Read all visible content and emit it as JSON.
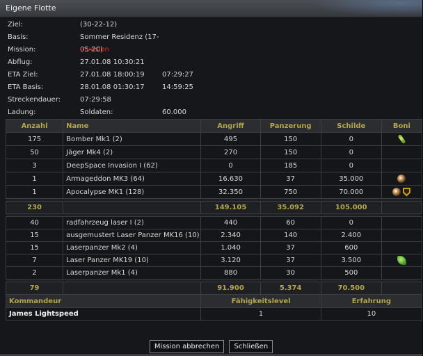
{
  "window": {
    "title": "Eigene Flotte"
  },
  "info": [
    {
      "label": "Ziel:",
      "v1": "(30-22-12)",
      "v2": "",
      "red": false
    },
    {
      "label": "Basis:",
      "v1": "Sommer Residenz (17-05-20)",
      "v2": "",
      "red": false
    },
    {
      "label": "Mission:",
      "v1": "Invasion",
      "v2": "",
      "red": true
    },
    {
      "label": "Abflug:",
      "v1": "27.01.08 10:30:21",
      "v2": "",
      "red": false
    },
    {
      "label": "ETA Ziel:",
      "v1": "27.01.08 18:00:19",
      "v2": "07:29:27",
      "red": false
    },
    {
      "label": "ETA Basis:",
      "v1": "28.01.08 01:30:17",
      "v2": "14:59:25",
      "red": false
    },
    {
      "label": "Streckendauer:",
      "v1": "07:29:58",
      "v2": "",
      "red": false
    },
    {
      "label": "Ladung:",
      "v1": "Soldaten:",
      "v2": "60.000",
      "red": false
    }
  ],
  "table": {
    "headers": {
      "count": "Anzahl",
      "name": "Name",
      "attack": "Angriff",
      "armor": "Panzerung",
      "shields": "Schilde",
      "bonus": "Boni"
    },
    "group1": [
      {
        "count": "175",
        "name": "Bomber Mk1 (2)",
        "attack": "495",
        "armor": "150",
        "shields": "0",
        "bonus": [
          "green-bonus-icon"
        ]
      },
      {
        "count": "50",
        "name": "Jäger Mk4 (2)",
        "attack": "270",
        "armor": "150",
        "shields": "0",
        "bonus": []
      },
      {
        "count": "3",
        "name": "DeepSpace Invasion I (62)",
        "attack": "0",
        "armor": "185",
        "shields": "0",
        "bonus": []
      },
      {
        "count": "1",
        "name": "Armageddon MK3 (64)",
        "attack": "16.630",
        "armor": "37",
        "shields": "35.000",
        "bonus": [
          "orb-bonus-icon"
        ]
      },
      {
        "count": "1",
        "name": "Apocalypse MK1 (128)",
        "attack": "32.350",
        "armor": "750",
        "shields": "70.000",
        "bonus": [
          "orb-bonus-icon",
          "shield-bonus-icon"
        ]
      }
    ],
    "total1": {
      "count": "230",
      "attack": "149.105",
      "armor": "35.092",
      "shields": "105.000"
    },
    "group2": [
      {
        "count": "40",
        "name": "radfahrzeug laser I (2)",
        "attack": "440",
        "armor": "60",
        "shields": "0",
        "bonus": []
      },
      {
        "count": "15",
        "name": "ausgemustert Laser Panzer MK16 (10)",
        "attack": "2.340",
        "armor": "140",
        "shields": "2.400",
        "bonus": []
      },
      {
        "count": "15",
        "name": "Laserpanzer Mk2 (4)",
        "attack": "1.040",
        "armor": "37",
        "shields": "600",
        "bonus": []
      },
      {
        "count": "7",
        "name": "Laser Panzer MK19 (10)",
        "attack": "3.120",
        "armor": "37",
        "shields": "3.500",
        "bonus": [
          "leaf-bonus-icon"
        ]
      },
      {
        "count": "2",
        "name": "Laserpanzer Mk1 (4)",
        "attack": "880",
        "armor": "30",
        "shields": "500",
        "bonus": []
      }
    ],
    "total2": {
      "count": "79",
      "attack": "91.900",
      "armor": "5.374",
      "shields": "70.500"
    },
    "commander": {
      "header_name": "Kommandeur",
      "header_skill": "Fähigkeitslevel",
      "header_exp": "Erfahrung",
      "name": "James Lightspeed",
      "skill": "1",
      "exp": "10"
    }
  },
  "buttons": {
    "abort": "Mission abbrechen",
    "close": "Schließen"
  },
  "colors": {
    "accent": "#b3a64a",
    "mission": "#e0302a"
  }
}
